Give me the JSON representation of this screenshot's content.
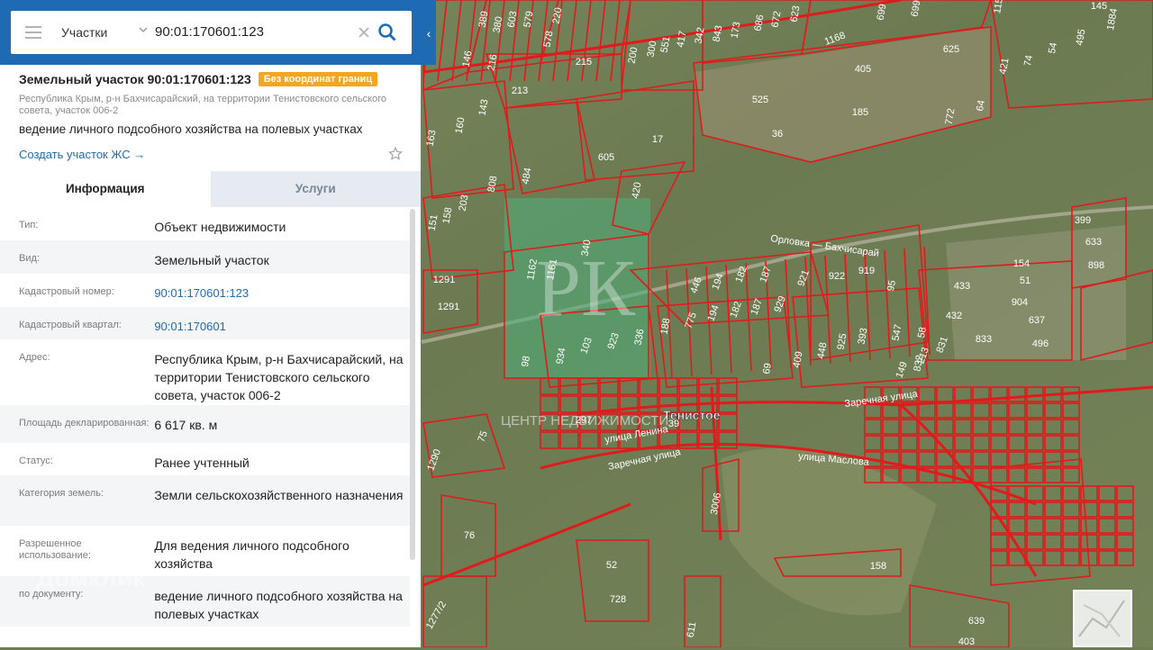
{
  "search": {
    "category": "Участки",
    "query": "90:01:170601:123"
  },
  "header": {
    "title": "Земельный участок 90:01:170601:123",
    "badge": "Без координат границ",
    "address": "Республика Крым, р-н Бахчисарайский, на территории Тенистовского сельского совета, участок 006-2",
    "use": "ведение личного подсобного хозяйства на полевых участках",
    "create_link": "Создать участок ЖС →"
  },
  "tabs": [
    "Информация",
    "Услуги"
  ],
  "info": [
    {
      "label": "Тип:",
      "value": "Объект недвижимости",
      "link": false
    },
    {
      "label": "Вид:",
      "value": "Земельный участок",
      "link": false
    },
    {
      "label": "Кадастровый номер:",
      "value": "90:01:170601:123",
      "link": true
    },
    {
      "label": "Кадастровый квартал:",
      "value": "90:01:170601",
      "link": true
    },
    {
      "label": "Адрес:",
      "value": "Республика Крым, р-н Бахчисарайский, на территории Тенистовского сельского совета, участок 006-2",
      "link": false
    },
    {
      "label": "Площадь декларированная:",
      "value": "6 617 кв. м",
      "link": false
    },
    {
      "label": "Статус:",
      "value": "Ранее учтенный",
      "link": false
    },
    {
      "label": "Категория земель:",
      "value": "Земли сельскохозяйственного назначения",
      "link": false
    },
    {
      "label": "Разрешенное использование:",
      "value": "Для ведения личного подсобного хозяйства",
      "link": false
    },
    {
      "label": "по документу:",
      "value": "ведение личного подсобного хозяйства на полевых участках",
      "link": false
    }
  ],
  "map": {
    "roads": [
      "Орловка — Бахчисарай",
      "Заречная улица",
      "улица Ленина",
      "Заречная улица",
      "улица Маслова"
    ],
    "village": "Тенистое",
    "watermark": "ЦЕНТР НЕДВИЖИМОСТИ",
    "plot_numbers": [
      "389",
      "380",
      "603",
      "579",
      "220",
      "578",
      "146",
      "216",
      "215",
      "200",
      "300",
      "551",
      "417",
      "342",
      "843",
      "173",
      "686",
      "672",
      "623",
      "1168",
      "699",
      "699",
      "1155",
      "1884",
      "145",
      "495",
      "625",
      "405",
      "421",
      "74",
      "54",
      "213",
      "143",
      "160",
      "163",
      "525",
      "185",
      "64",
      "772",
      "36",
      "605",
      "17",
      "808",
      "484",
      "420",
      "203",
      "158",
      "151",
      "1291",
      "1291",
      "1162",
      "1161",
      "340",
      "399",
      "633",
      "898",
      "154",
      "433",
      "51",
      "904",
      "637",
      "496",
      "432",
      "833",
      "831",
      "213",
      "149",
      "103",
      "923",
      "336",
      "188",
      "775",
      "446",
      "194",
      "182",
      "187",
      "929",
      "921",
      "922",
      "919",
      "95",
      "409",
      "448",
      "925",
      "393",
      "547",
      "58",
      "832",
      "194",
      "182",
      "187",
      "98",
      "934",
      "297",
      "75",
      "1290",
      "76",
      "52",
      "728",
      "158",
      "639",
      "403",
      "611",
      "1277/2",
      "3006",
      "69",
      "39"
    ],
    "colors": {
      "parcel": "#e01b1b",
      "map_bg": "#6f7d55"
    }
  },
  "brand_watermark": "Домклик"
}
